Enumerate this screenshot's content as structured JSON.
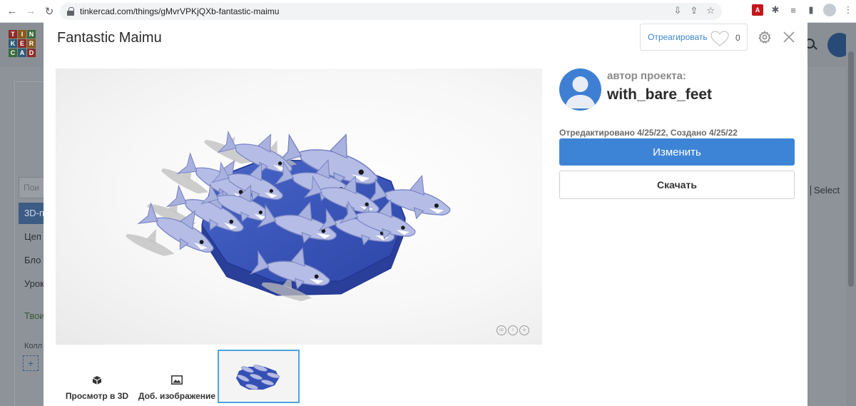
{
  "browser": {
    "url": "tinkercad.com/things/gMvrVPKjQXb-fantastic-maimu"
  },
  "background": {
    "logo_letters": [
      "T",
      "I",
      "N",
      "K",
      "E",
      "R",
      "C",
      "A",
      "D"
    ],
    "search_placeholder": "Пои",
    "sidebar_items": [
      "3D-п",
      "Цеп",
      "Бло",
      "Урок"
    ],
    "green_item": "Твои",
    "collections_label": "Колл",
    "add_label": "+",
    "select_label": "Select"
  },
  "modal": {
    "title": "Fantastic Maimu",
    "react_label": "Отреагировать",
    "react_count": "0",
    "author_label": "автор проекта:",
    "author_name": "with_bare_feet",
    "dates": "Отредактировано 4/25/22, Создано 4/25/22",
    "edit_label": "Изменить",
    "download_label": "Скачать",
    "view3d_label": "Просмотр в 3D",
    "add_image_label": "Доб. изображение",
    "accent_color": "#3e84d6",
    "selected_thumb_border": "#4ea3df"
  }
}
